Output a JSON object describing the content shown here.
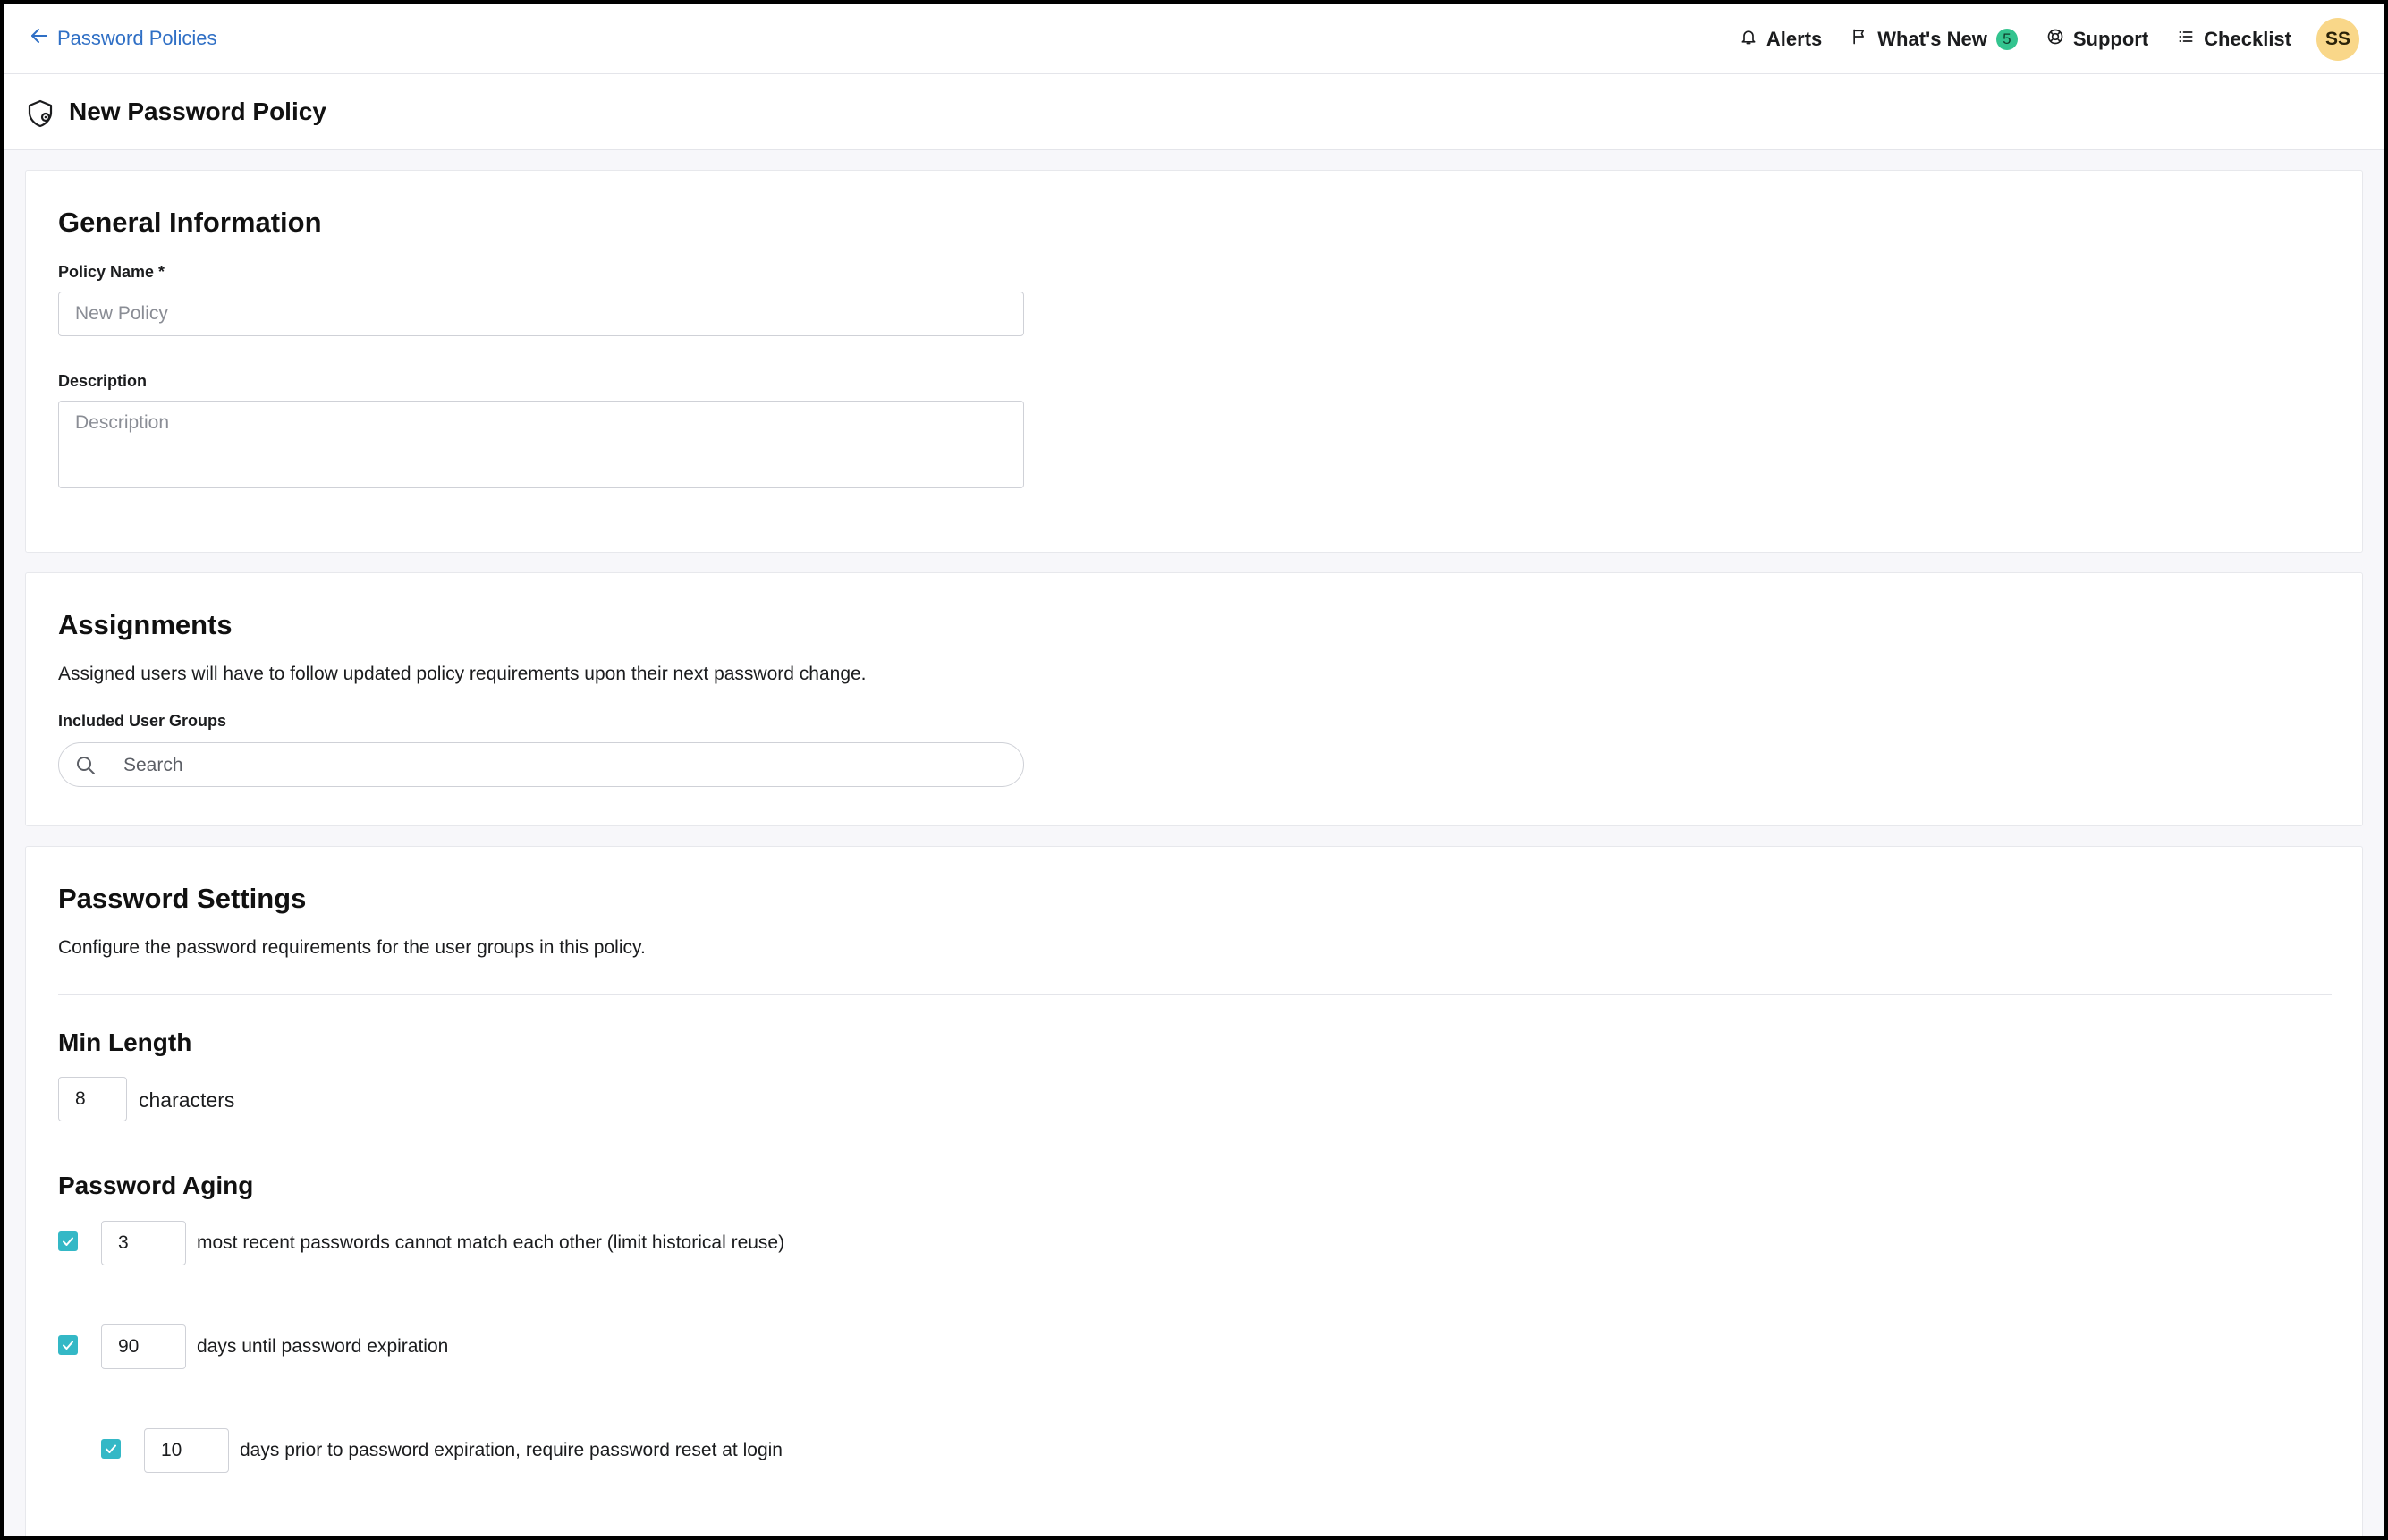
{
  "topbar": {
    "back_label": "Password Policies",
    "nav": {
      "alerts": "Alerts",
      "whats_new": "What's New",
      "whats_new_count": "5",
      "support": "Support",
      "checklist": "Checklist"
    },
    "avatar_initials": "SS"
  },
  "page": {
    "title": "New Password Policy",
    "title_icon": "shield-gear-icon"
  },
  "general": {
    "heading": "General Information",
    "policy_name_label": "Policy Name *",
    "policy_name_placeholder": "New Policy",
    "policy_name_value": "",
    "description_label": "Description",
    "description_placeholder": "Description",
    "description_value": ""
  },
  "assignments": {
    "heading": "Assignments",
    "helper": "Assigned users will have to follow updated policy requirements upon their next password change.",
    "groups_label": "Included User Groups",
    "search_placeholder": "Search",
    "search_value": ""
  },
  "password_settings": {
    "heading": "Password Settings",
    "helper": "Configure the password requirements for the user groups in this policy.",
    "min_length": {
      "heading": "Min Length",
      "value": "8",
      "unit": "characters"
    },
    "aging": {
      "heading": "Password Aging",
      "rules": [
        {
          "checked": true,
          "value": "3",
          "text": "most recent passwords cannot match each other (limit historical reuse)"
        },
        {
          "checked": true,
          "value": "90",
          "text": "days until password expiration"
        },
        {
          "checked": true,
          "value": "10",
          "text": "days prior to password expiration, require password reset at login"
        }
      ]
    }
  },
  "colors": {
    "link": "#2f6fc5",
    "checkbox": "#34b8c6",
    "badge": "#33c48f",
    "avatar": "#f9d789"
  }
}
